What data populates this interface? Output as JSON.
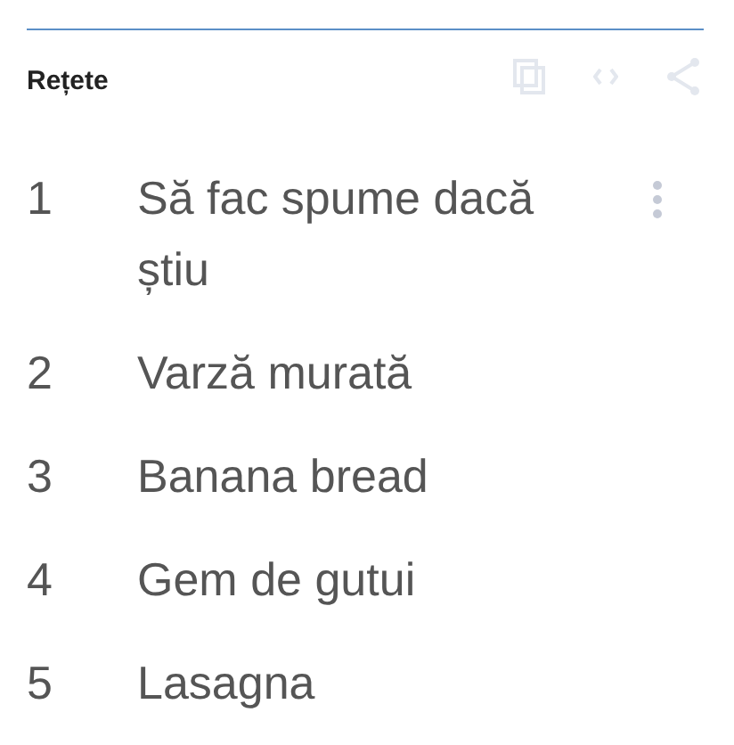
{
  "title": "Rețete",
  "items": [
    {
      "number": "1",
      "text": "Să fac spume dacă știu",
      "menu_visible": true
    },
    {
      "number": "2",
      "text": "Varză murată",
      "menu_visible": false
    },
    {
      "number": "3",
      "text": "Banana bread",
      "menu_visible": false
    },
    {
      "number": "4",
      "text": "Gem de gutui",
      "menu_visible": false
    },
    {
      "number": "5",
      "text": "Lasagna",
      "menu_visible": false
    }
  ]
}
